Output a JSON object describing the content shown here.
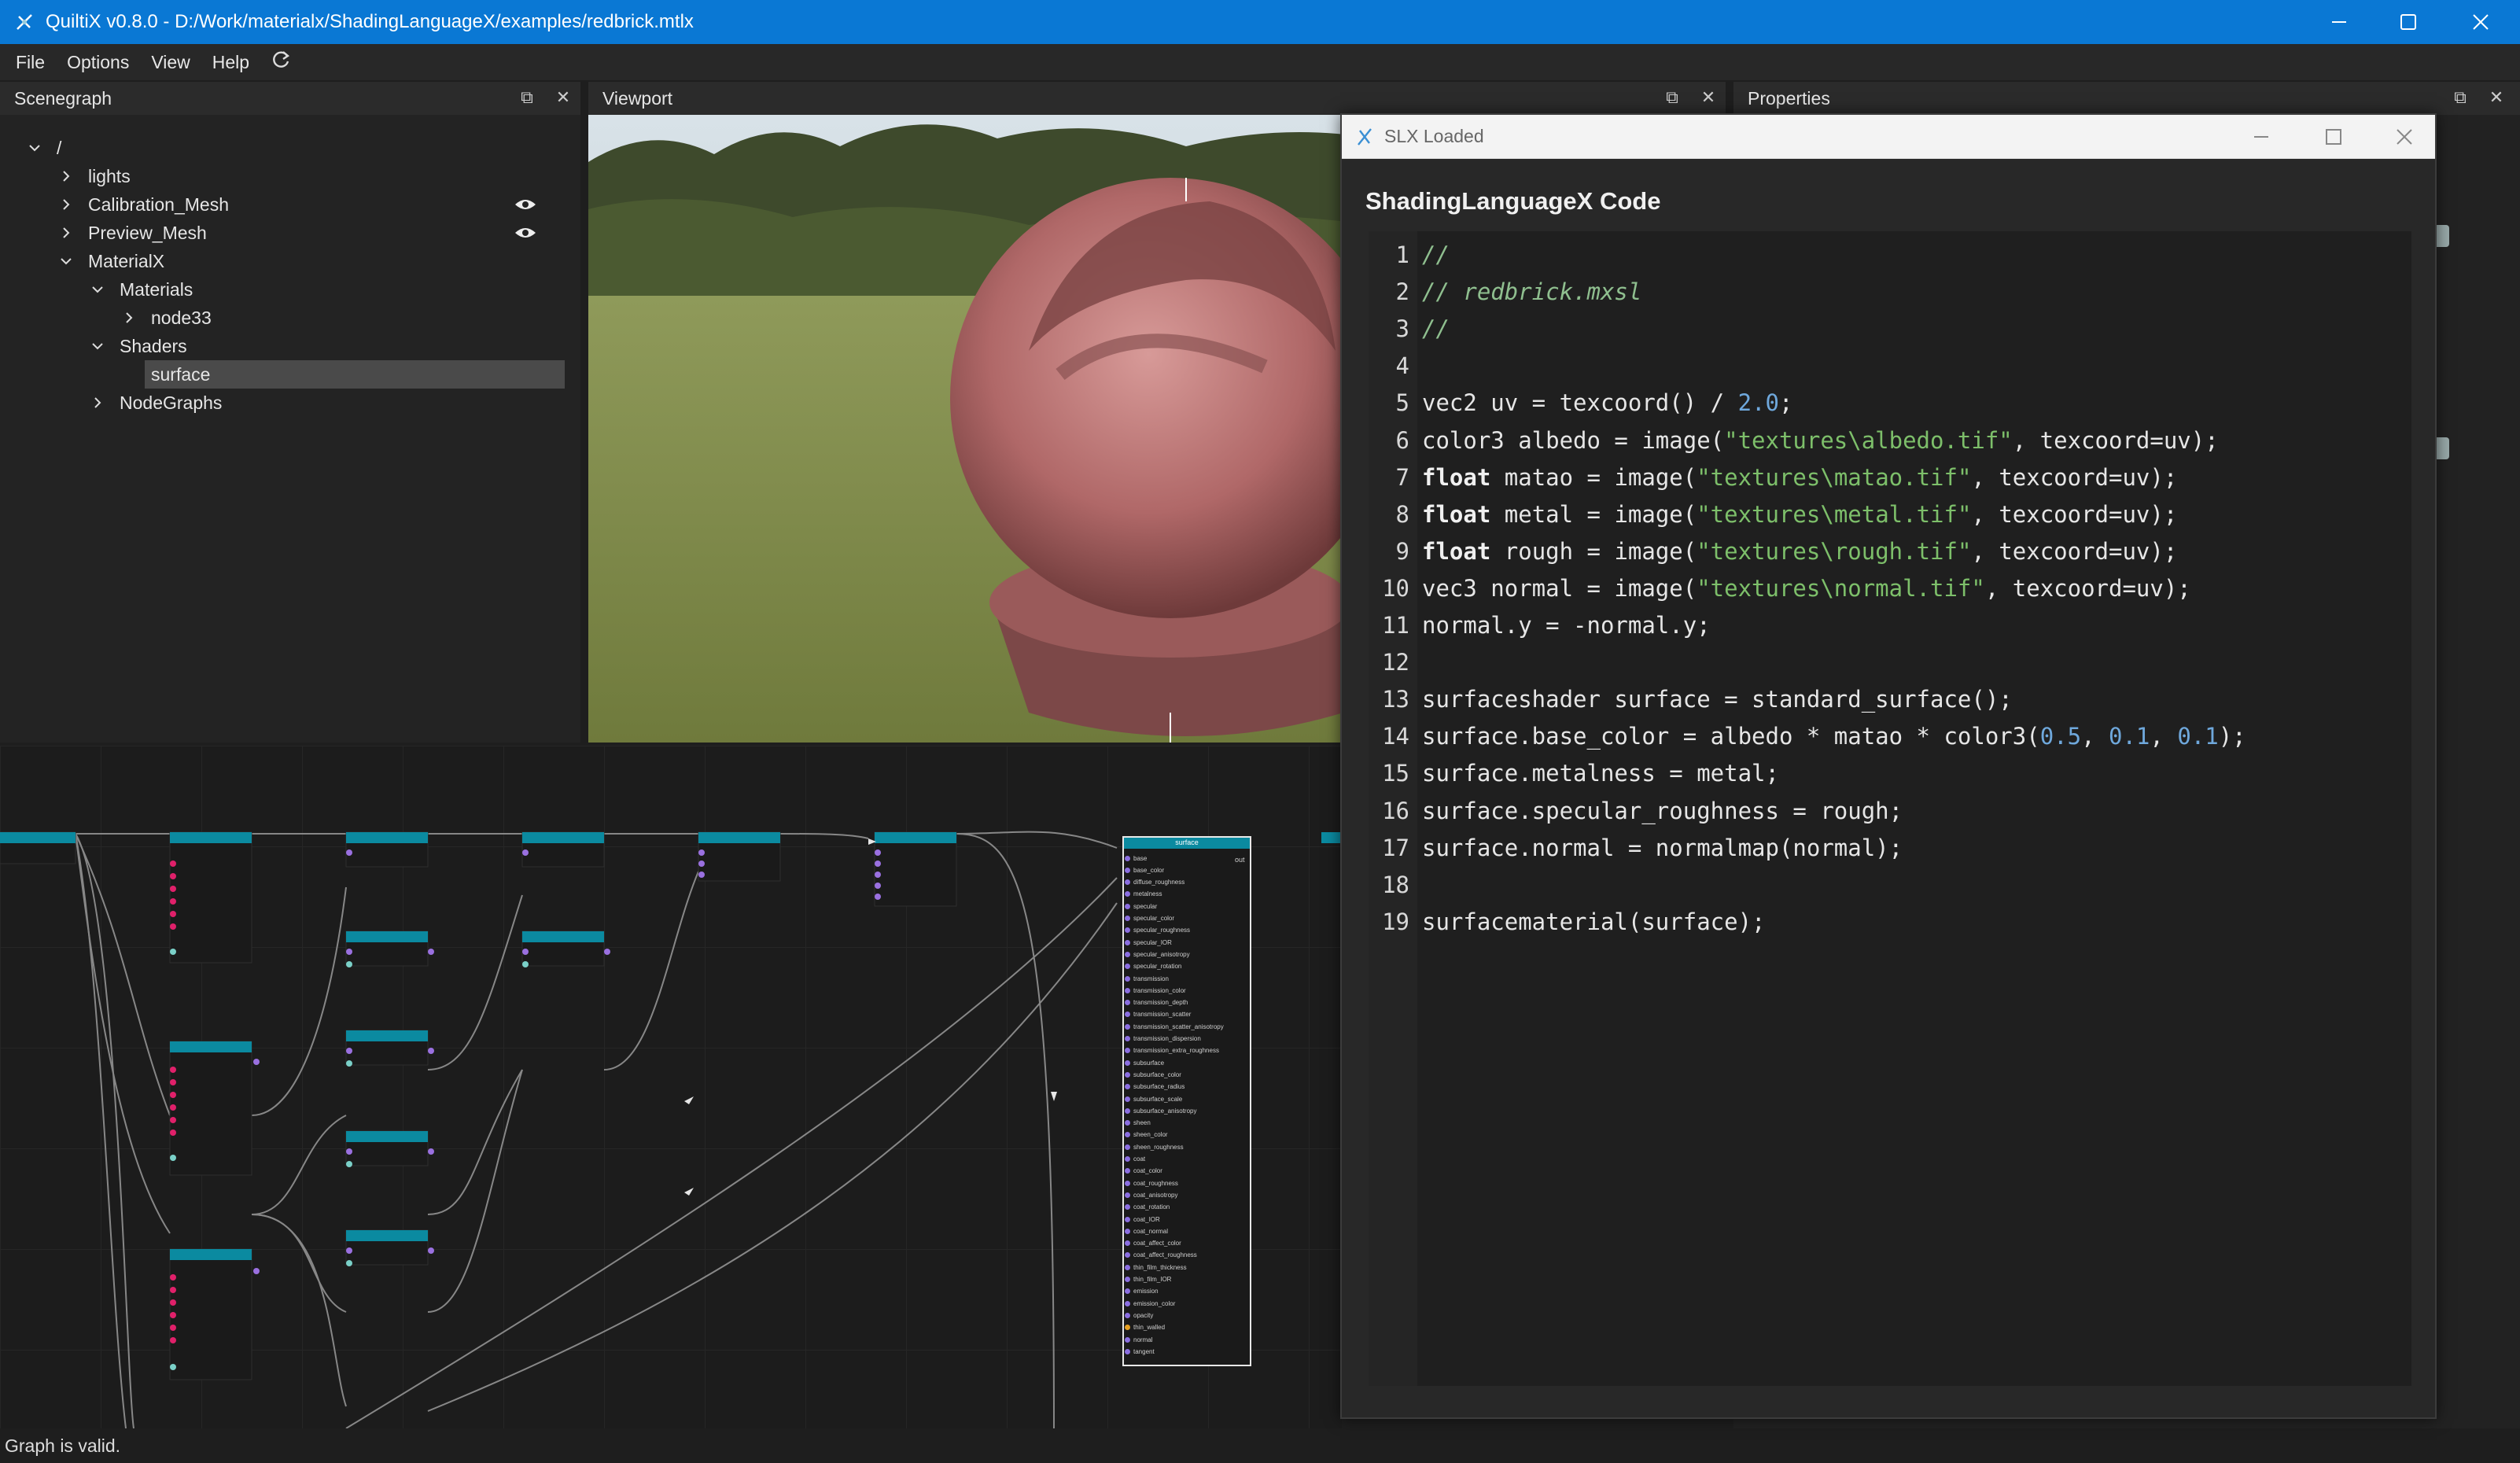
{
  "window": {
    "title": "QuiltiX v0.8.0 - D:/Work/materialx/ShadingLanguageX/examples/redbrick.mtlx"
  },
  "menu": {
    "items": [
      "File",
      "Options",
      "View",
      "Help"
    ]
  },
  "scenegraph": {
    "title": "Scenegraph",
    "items": [
      {
        "label": "/",
        "expanded": true
      },
      {
        "label": "lights",
        "expanded": false
      },
      {
        "label": "Calibration_Mesh",
        "expanded": false,
        "visible": true
      },
      {
        "label": "Preview_Mesh",
        "expanded": false,
        "visible": true
      },
      {
        "label": "MaterialX",
        "expanded": true
      },
      {
        "label": "Materials",
        "expanded": true
      },
      {
        "label": "node33",
        "expanded": false
      },
      {
        "label": "Shaders",
        "expanded": true
      },
      {
        "label": "surface",
        "selected": true
      },
      {
        "label": "NodeGraphs",
        "expanded": false
      }
    ]
  },
  "viewport": {
    "title": "Viewport"
  },
  "properties": {
    "title": "Properties"
  },
  "graph": {
    "surface_node_title": "surface",
    "surface_output": "out",
    "surface_inputs": [
      "base",
      "base_color",
      "diffuse_roughness",
      "metalness",
      "specular",
      "specular_color",
      "specular_roughness",
      "specular_IOR",
      "specular_anisotropy",
      "specular_rotation",
      "transmission",
      "transmission_color",
      "transmission_depth",
      "transmission_scatter",
      "transmission_scatter_anisotropy",
      "transmission_dispersion",
      "transmission_extra_roughness",
      "subsurface",
      "subsurface_color",
      "subsurface_radius",
      "subsurface_scale",
      "subsurface_anisotropy",
      "sheen",
      "sheen_color",
      "sheen_roughness",
      "coat",
      "coat_color",
      "coat_roughness",
      "coat_anisotropy",
      "coat_rotation",
      "coat_IOR",
      "coat_normal",
      "coat_affect_color",
      "coat_affect_roughness",
      "thin_film_thickness",
      "thin_film_IOR",
      "emission",
      "emission_color",
      "opacity",
      "thin_walled",
      "normal",
      "tangent"
    ]
  },
  "status": {
    "text": "Graph is valid."
  },
  "dialog": {
    "window_title": "SLX Loaded",
    "heading": "ShadingLanguageX Code",
    "lines": [
      {
        "n": "1",
        "code": "//"
      },
      {
        "n": "2",
        "code": "// redbrick.mxsl"
      },
      {
        "n": "3",
        "code": "//"
      },
      {
        "n": "4",
        "code": ""
      },
      {
        "n": "5",
        "code": "vec2 uv = texcoord() / 2.0;"
      },
      {
        "n": "6",
        "code": "color3 albedo = image(\"textures\\albedo.tif\", texcoord=uv);"
      },
      {
        "n": "7",
        "code": "float matao = image(\"textures\\matao.tif\", texcoord=uv);"
      },
      {
        "n": "8",
        "code": "float metal = image(\"textures\\metal.tif\", texcoord=uv);"
      },
      {
        "n": "9",
        "code": "float rough = image(\"textures\\rough.tif\", texcoord=uv);"
      },
      {
        "n": "10",
        "code": "vec3 normal = image(\"textures\\normal.tif\", texcoord=uv);"
      },
      {
        "n": "11",
        "code": "normal.y = -normal.y;"
      },
      {
        "n": "12",
        "code": ""
      },
      {
        "n": "13",
        "code": "surfaceshader surface = standard_surface();"
      },
      {
        "n": "14",
        "code": "surface.base_color = albedo * matao * color3(0.5, 0.1, 0.1);"
      },
      {
        "n": "15",
        "code": "surface.metalness = metal;"
      },
      {
        "n": "16",
        "code": "surface.specular_roughness = rough;"
      },
      {
        "n": "17",
        "code": "surface.normal = normalmap(normal);"
      },
      {
        "n": "18",
        "code": ""
      },
      {
        "n": "19",
        "code": "surfacematerial(surface);"
      }
    ]
  },
  "colors": {
    "titlebar": "#0a78d4",
    "node_header": "#0b8aa0",
    "selection": "#4a4a4a"
  }
}
